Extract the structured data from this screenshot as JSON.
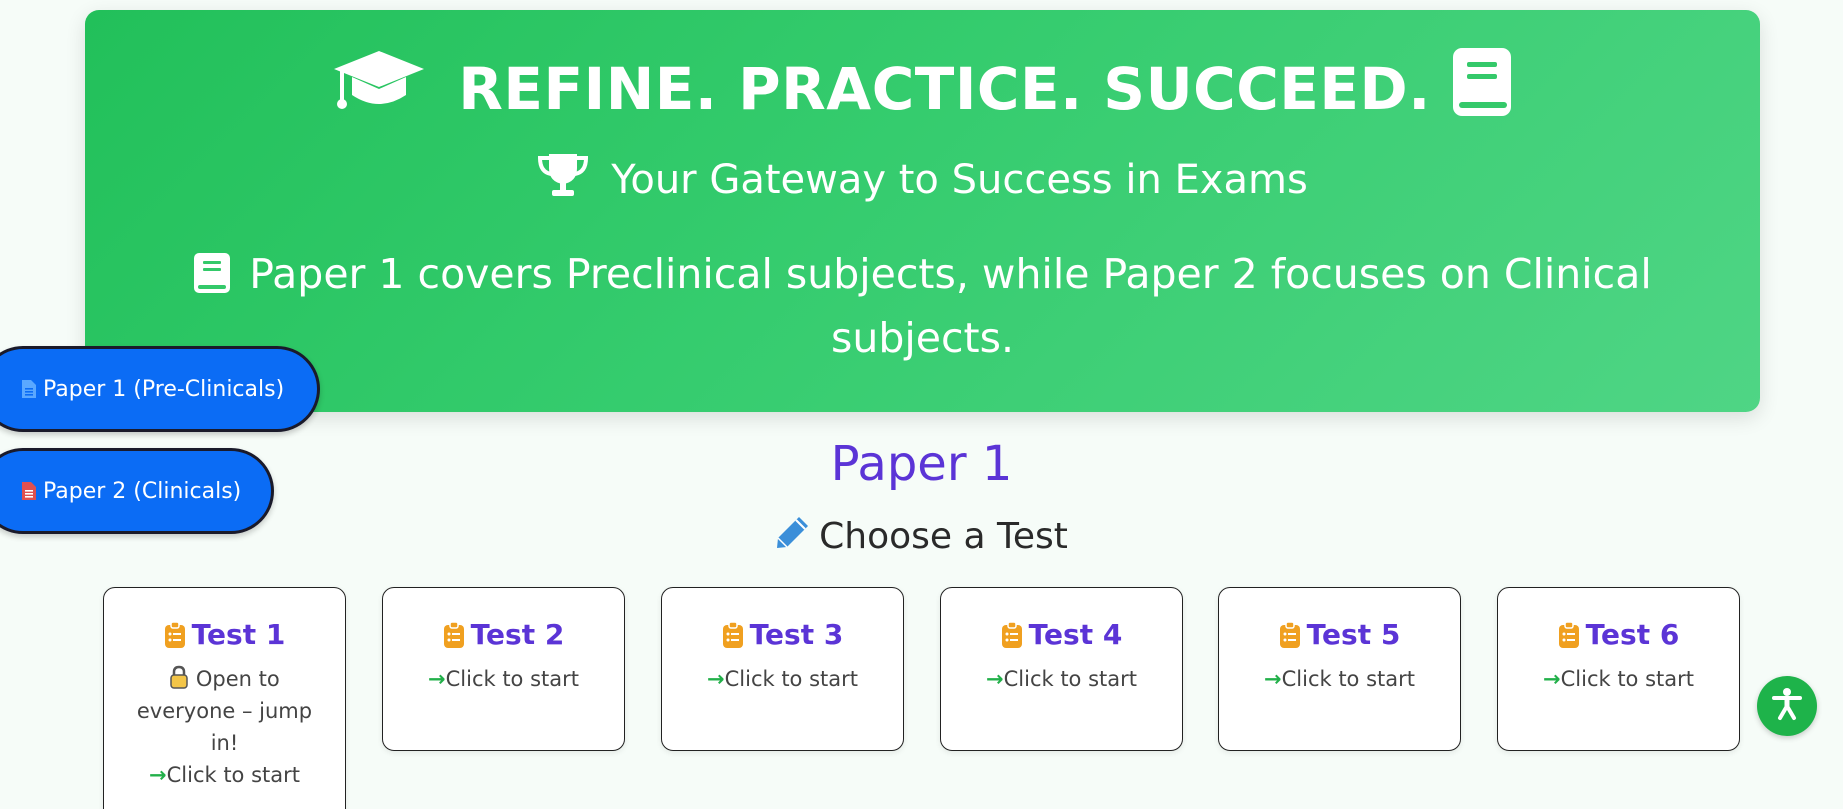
{
  "hero": {
    "title": "REFINE. PRACTICE. SUCCEED.",
    "subtitle": "Your Gateway to Success in Exams",
    "description": "Paper 1 covers Preclinical subjects, while Paper 2 focuses on Clinical subjects.",
    "icons": [
      "graduation-cap-icon",
      "book-icon",
      "trophy-icon"
    ]
  },
  "nav": {
    "paper1_label": "Paper 1 (Pre-Clinicals)",
    "paper2_label": "Paper 2 (Clinicals)"
  },
  "main": {
    "section_title": "Paper 1",
    "choose_label": "Choose a Test",
    "tests": [
      {
        "name": "Test 1",
        "note": "Open to everyone – jump in!",
        "action": "Click to start"
      },
      {
        "name": "Test 2",
        "action": "Click to start"
      },
      {
        "name": "Test 3",
        "action": "Click to start"
      },
      {
        "name": "Test 4",
        "action": "Click to start"
      },
      {
        "name": "Test 5",
        "action": "Click to start"
      },
      {
        "name": "Test 6",
        "action": "Click to start"
      }
    ]
  },
  "colors": {
    "hero_green": "#2cc462",
    "button_blue": "#0b6cf5",
    "title_purple": "#5b34d6",
    "clipboard_orange": "#f0a020",
    "arrow_green": "#22b04a"
  }
}
